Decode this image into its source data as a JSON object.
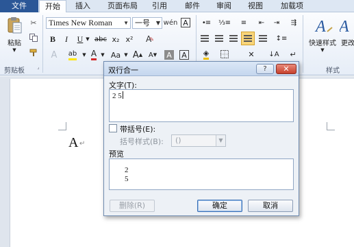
{
  "tabs": {
    "file": "文件",
    "items": [
      "开始",
      "插入",
      "页面布局",
      "引用",
      "邮件",
      "审阅",
      "视图",
      "加载项"
    ]
  },
  "ribbon": {
    "clipboard": {
      "paste_label": "粘贴",
      "group_label": "剪贴板"
    },
    "font": {
      "font_name": "Times New Roman",
      "font_size": "一号",
      "bold": "B",
      "italic": "I",
      "underline": "U",
      "strike": "abc",
      "subscript": "x₂",
      "superscript": "x²",
      "highlight": "ab",
      "font_color": "A",
      "change_case": "Aa",
      "grow": "A",
      "shrink": "A",
      "clear_format": "A",
      "char_border": "A",
      "phonetic": "wén",
      "enclose": "A"
    },
    "paragraph": {},
    "styles": {
      "quick_styles_label": "快速样式",
      "change_styles_label": "更改",
      "group_label": "样式"
    }
  },
  "document": {
    "text": "A",
    "para_mark": "↵"
  },
  "dialog": {
    "title": "双行合一",
    "help": "?",
    "close": "✕",
    "text_label": "文字(T):",
    "text_value": "2 5",
    "brackets_label": "带括号(E):",
    "bracket_style_label": "括号样式(B):",
    "bracket_style_value": "()",
    "preview_label": "预览",
    "preview_line1": "2",
    "preview_line2": "5",
    "delete_button": "删除(R)",
    "ok_button": "确定",
    "cancel_button": "取消"
  }
}
